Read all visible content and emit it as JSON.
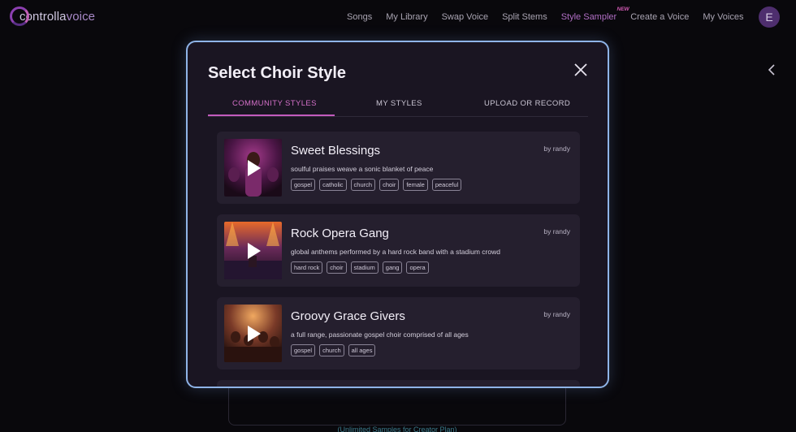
{
  "brand": {
    "name_prefix": "controlla",
    "name_suffix": "voice"
  },
  "nav": {
    "items": [
      {
        "label": "Songs"
      },
      {
        "label": "My Library"
      },
      {
        "label": "Swap Voice"
      },
      {
        "label": "Split Stems"
      },
      {
        "label": "Style Sampler",
        "badge": "NEW"
      },
      {
        "label": "Create a Voice"
      },
      {
        "label": "My Voices"
      }
    ],
    "avatar_initial": "E"
  },
  "modal": {
    "title": "Select Choir Style",
    "tabs": [
      {
        "label": "COMMUNITY STYLES",
        "active": true
      },
      {
        "label": "MY STYLES",
        "active": false
      },
      {
        "label": "UPLOAD OR RECORD",
        "active": false
      }
    ],
    "styles": [
      {
        "title": "Sweet Blessings",
        "author": "by randy",
        "description": "soulful praises weave a sonic blanket of peace",
        "tags": [
          "gospel",
          "catholic",
          "church",
          "choir",
          "female",
          "peaceful"
        ]
      },
      {
        "title": "Rock Opera Gang",
        "author": "by randy",
        "description": "global anthems performed by a hard rock band with a stadium crowd",
        "tags": [
          "hard rock",
          "choir",
          "stadium",
          "gang",
          "opera"
        ]
      },
      {
        "title": "Groovy Grace Givers",
        "author": "by randy",
        "description": "a full range, passionate gospel choir comprised of all ages",
        "tags": [
          "gospel",
          "church",
          "all ages"
        ]
      }
    ]
  },
  "background": {
    "caption": "(Unlimited Samples for Creator Plan)"
  },
  "colors": {
    "accent": "#c35bbd",
    "modal_border": "#8fb4e8",
    "active_nav": "#b06ec4"
  }
}
